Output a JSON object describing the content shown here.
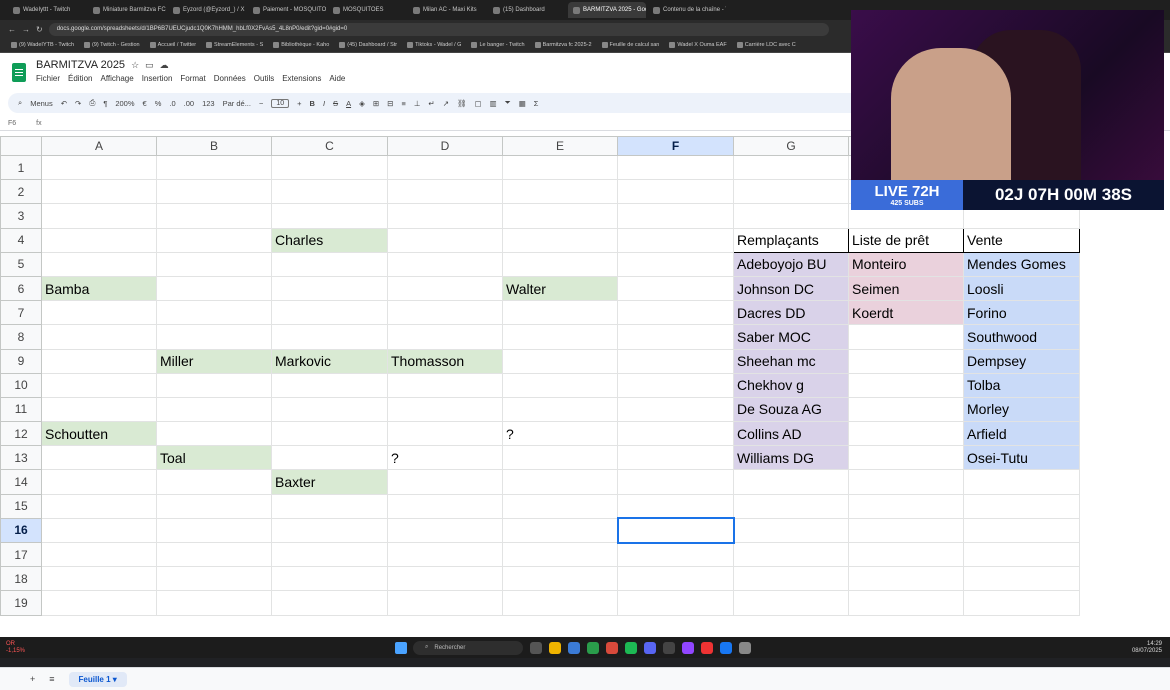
{
  "browser": {
    "tabs": [
      "WadeIyttt - Twitch",
      "Miniature Barmitzva FC - Episo",
      "Eyzord (@Eyzord_) / X",
      "Paiement - MOSQUITOES",
      "MOSQUITOES",
      "Milan AC - Maxi Kits",
      "(15) Dashboard",
      "BARMITZVA 2025 - Google Sh",
      "Contenu de la chaîne - YouTub"
    ],
    "active_tab_index": 7,
    "url": "docs.google.com/spreadsheets/d/1BP6B7UEUCjudc1Q0K7hHMM_hbLf0X2FvAs5_4L8nP0/edit?gid=0#gid=0",
    "bookmarks": [
      "(9) WadeIYTB - Twitch",
      "(9) Twitch - Gestion",
      "Accueil / Twitter",
      "StreamElements - S",
      "Bibliothèque - Kaho",
      "(45) Dashboard / Str",
      "Tiktoks - Wadel / G",
      "Le banger - Twitch",
      "Barmitzva fc 2025-2",
      "Feuille de calcul san",
      "Wadel X Ouma EAF",
      "Carrière LDC avec C"
    ]
  },
  "sheets": {
    "title": "BARMITZVA 2025",
    "menus": [
      "Fichier",
      "Édition",
      "Affichage",
      "Insertion",
      "Format",
      "Données",
      "Outils",
      "Extensions",
      "Aide"
    ],
    "toolbar": {
      "menus_label": "Menus",
      "zoom": "200%",
      "currency": "€",
      "percent": "%",
      "decimals_dec": ".0",
      "decimals_inc": ".00",
      "format_123": "123",
      "font": "Par dé...",
      "font_size": "10",
      "bold": "B",
      "italic": "I",
      "strike": "S",
      "text_color": "A",
      "sum": "Σ"
    },
    "name_box": "F6",
    "fx": "fx",
    "columns": [
      "A",
      "B",
      "C",
      "D",
      "E",
      "F",
      "G",
      "H",
      "I"
    ],
    "selected_column": "F",
    "selected_row": "16",
    "rows": [
      {
        "n": "1",
        "cells": [
          "",
          "",
          "",
          "",
          "",
          "",
          "",
          "",
          ""
        ]
      },
      {
        "n": "2",
        "cells": [
          "",
          "",
          "",
          "",
          "",
          "",
          "",
          "",
          ""
        ]
      },
      {
        "n": "3",
        "cells": [
          "",
          "",
          "",
          "",
          "",
          "",
          "",
          "",
          ""
        ]
      },
      {
        "n": "4",
        "cells": [
          "",
          "",
          "Charles",
          "",
          "",
          "",
          "Remplaçants",
          "Liste de prêt",
          "Vente"
        ]
      },
      {
        "n": "5",
        "cells": [
          "",
          "",
          "",
          "",
          "",
          "",
          "Adeboyojo BU",
          "Monteiro",
          "Mendes Gomes"
        ]
      },
      {
        "n": "6",
        "cells": [
          "Bamba",
          "",
          "",
          "",
          "Walter",
          "",
          "Johnson DC",
          "Seimen",
          "Loosli"
        ]
      },
      {
        "n": "7",
        "cells": [
          "",
          "",
          "",
          "",
          "",
          "",
          "Dacres DD",
          "Koerdt",
          "Forino"
        ]
      },
      {
        "n": "8",
        "cells": [
          "",
          "",
          "",
          "",
          "",
          "",
          "Saber MOC",
          "",
          "Southwood"
        ]
      },
      {
        "n": "9",
        "cells": [
          "",
          "Miller",
          "Markovic",
          "Thomasson",
          "",
          "",
          "Sheehan mc",
          "",
          "Dempsey"
        ]
      },
      {
        "n": "10",
        "cells": [
          "",
          "",
          "",
          "",
          "",
          "",
          "Chekhov g",
          "",
          "Tolba"
        ]
      },
      {
        "n": "11",
        "cells": [
          "",
          "",
          "",
          "",
          "",
          "",
          "De Souza AG",
          "",
          "Morley"
        ]
      },
      {
        "n": "12",
        "cells": [
          "Schoutten",
          "",
          "",
          "",
          "?",
          "",
          "Collins AD",
          "",
          "Arfield"
        ]
      },
      {
        "n": "13",
        "cells": [
          "",
          "Toal",
          "",
          "?",
          "",
          "",
          "Williams DG",
          "",
          "Osei-Tutu"
        ]
      },
      {
        "n": "14",
        "cells": [
          "",
          "",
          "Baxter",
          "",
          "",
          "",
          "",
          "",
          ""
        ]
      },
      {
        "n": "15",
        "cells": [
          "",
          "",
          "",
          "",
          "",
          "",
          "",
          "",
          ""
        ]
      },
      {
        "n": "16",
        "cells": [
          "",
          "",
          "",
          "",
          "",
          "",
          "",
          "",
          ""
        ]
      },
      {
        "n": "17",
        "cells": [
          "",
          "",
          "",
          "",
          "",
          "",
          "",
          "",
          ""
        ]
      },
      {
        "n": "18",
        "cells": [
          "",
          "",
          "",
          "",
          "",
          "",
          "",
          "",
          ""
        ]
      },
      {
        "n": "19",
        "cells": [
          "",
          "",
          "",
          "",
          "",
          "",
          "",
          "",
          ""
        ]
      }
    ],
    "sheet_tab": "Feuille 1",
    "add_sheet": "+",
    "all_sheets": "≡"
  },
  "stream_overlay": {
    "live_label": "LIVE 72H",
    "subs_label": "425 SUBS",
    "timer": "02J 07H 00M 38S"
  },
  "taskbar": {
    "search_placeholder": "Rechercher",
    "weather_temp": "OR",
    "weather_change": "-1,15%",
    "time": "14:29",
    "date": "08/07/2025"
  },
  "colors": {
    "green_cell": "#d9ead3",
    "purple_cell": "#d9d2e9",
    "pink_cell": "#ead1dc",
    "blue_cell": "#c9daf8",
    "live_blue": "#3a6cd9",
    "sheets_green": "#0f9d58"
  }
}
